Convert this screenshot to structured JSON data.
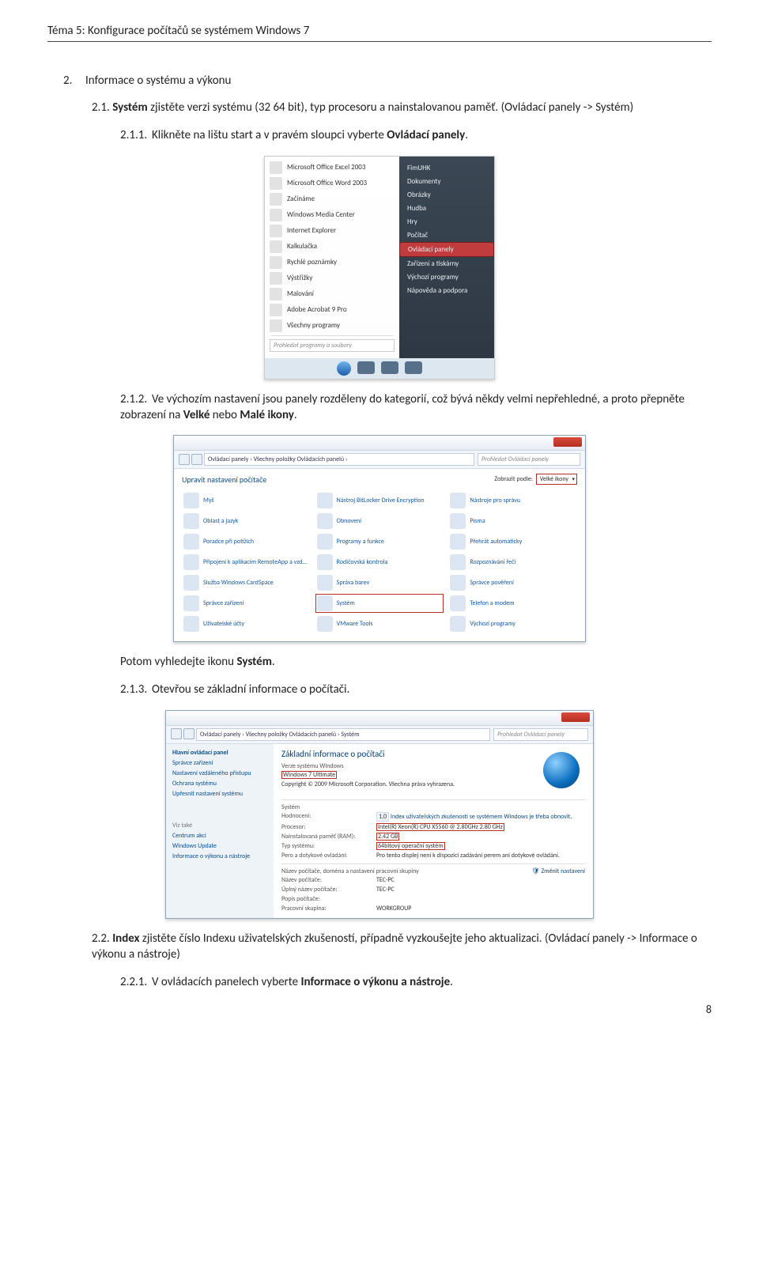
{
  "header": "Téma 5: Konfigurace počítačů se systémem Windows 7",
  "section2": {
    "num": "2.",
    "title": "Informace o systému a výkonu"
  },
  "s21": {
    "num": "2.1.",
    "text_a": "Systém zjistěte verzi systému (32 64 bit), typ procesoru a nainstalovanou paměť. (Ovládací panely -> Systém)",
    "text_bold": "Systém"
  },
  "s211": {
    "num": "2.1.1.",
    "text": "Klikněte na lištu start a v pravém sloupci vyberte ",
    "bold": "Ovládací panely",
    "tail": "."
  },
  "s212": {
    "num": "2.1.2.",
    "text": "Ve výchozím nastavení jsou panely rozděleny do kategorií, což bývá někdy velmi nepřehledné, a proto přepněte zobrazení na ",
    "bold": "Velké",
    "mid": " nebo ",
    "bold2": "Malé ikony",
    "tail": "."
  },
  "after_cpan_line": {
    "text": "Potom vyhledejte ikonu ",
    "bold": "Systém",
    "tail": "."
  },
  "s213": {
    "num": "2.1.3.",
    "text": "Otevřou se základní informace o počítači."
  },
  "s22": {
    "num": "2.2.",
    "bold": "Index",
    "text": " zjistěte číslo Indexu uživatelských zkušeností, případně vyzkoušejte jeho aktualizaci. (Ovládací panely -> Informace o výkonu a nástroje)"
  },
  "s221": {
    "num": "2.2.1.",
    "text": "V ovládacích panelech vyberte ",
    "bold": "Informace o výkonu a nástroje",
    "tail": "."
  },
  "page_number": "8",
  "startmenu": {
    "left_items": [
      "Microsoft Office Excel 2003",
      "Microsoft Office Word 2003",
      "Začínáme",
      "Windows Media Center",
      "Internet Explorer",
      "Kalkulačka",
      "Rychlé poznámky",
      "Výstřižky",
      "Malování",
      "Adobe Acrobat 9 Pro",
      "Všechny programy"
    ],
    "search_placeholder": "Prohledat programy a soubory",
    "right_items": [
      "FimUHK",
      "Dokumenty",
      "Obrázky",
      "Hudba",
      "Hry",
      "Počítač",
      "Ovládací panely",
      "Zařízení a tiskárny",
      "Výchozí programy",
      "Nápověda a podpora"
    ],
    "right_highlight_index": 6
  },
  "cpanel": {
    "breadcrumb": "Ovládací panely  ›  Všechny položky Ovládacích panelů  ›",
    "search_placeholder": "Prohledat Ovládací panely",
    "heading": "Upravit nastavení počítače",
    "view_label": "Zobrazit podle:",
    "view_value": "Velké ikony",
    "items": [
      "Myš",
      "Nástroj BitLocker Drive Encryption",
      "Nástroje pro správu",
      "Oblast a jazyk",
      "Obnovení",
      "Písma",
      "Poradce při potížích",
      "Programy a funkce",
      "Přehrát automaticky",
      "Připojení k aplikacím RemoteApp a vzd…",
      "Rodičovská kontrola",
      "Rozpoznávání řeči",
      "Služba Windows CardSpace",
      "Správa barev",
      "Správce pověření",
      "Správce zařízení",
      "Systém",
      "Telefon a modem",
      "Uživatelské účty",
      "VMware Tools",
      "Výchozí programy"
    ],
    "highlight_index": 16
  },
  "systemwin": {
    "breadcrumb": "Ovládací panely  ›  Všechny položky Ovládacích panelů  ›  Systém",
    "search_placeholder": "Prohledat Ovládací panely",
    "side_heading": "Hlavní ovládací panel",
    "side_links": [
      "Správce zařízení",
      "Nastavení vzdáleného přístupu",
      "Ochrana systému",
      "Upřesnit nastavení systému"
    ],
    "see_also_heading": "Viz také",
    "see_also": [
      "Centrum akcí",
      "Windows Update",
      "Informace o výkonu a nástroje"
    ],
    "main_heading": "Základní informace o počítači",
    "edition_heading": "Verze systému Windows",
    "edition_value": "Windows 7 Ultimate",
    "copyright": "Copyright © 2009 Microsoft Corporation. Všechna práva vyhrazena.",
    "system_heading": "Systém",
    "rows": {
      "rating_k": "Hodnocení:",
      "rating_v": "1,0",
      "rating_note": "Index uživatelských zkušeností se systémem Windows je třeba obnovit.",
      "cpu_k": "Procesor:",
      "cpu_v": "Intel(R) Xeon(R) CPU    X5560 @ 2.80GHz  2.80 GHz",
      "ram_k": "Nainstalovaná paměť (RAM):",
      "ram_v": "2,42 GB",
      "type_k": "Typ systému:",
      "type_v": "64bitový operační systém",
      "pen_k": "Pero a dotykové ovládání:",
      "pen_v": "Pro tento displej není k dispozici zadávání perem ani dotykové ovládání."
    },
    "net_heading": "Název počítače, doména a nastavení pracovní skupiny",
    "net_rows": {
      "name_k": "Název počítače:",
      "name_v": "TEC-PC",
      "full_k": "Úplný název počítače:",
      "full_v": "TEC-PC",
      "desc_k": "Popis počítače:",
      "desc_v": "",
      "wg_k": "Pracovní skupina:",
      "wg_v": "WORKGROUP"
    },
    "change_settings": "Změnit nastavení"
  }
}
